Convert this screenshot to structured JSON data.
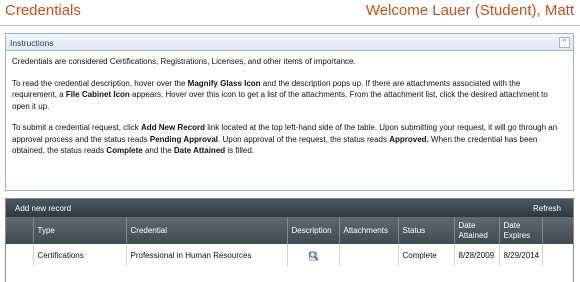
{
  "header": {
    "title": "Credentials",
    "welcome": "Welcome Lauer (Student), Matt"
  },
  "instructions": {
    "title": "Instructions",
    "p1": "Credentials are considered Certifications, Registrations, Licenses, and other items of importance.",
    "p2_a": "To read the credential description, hover over the ",
    "p2_b": "Magnify Glass Icon",
    "p2_c": " and the description pops up.  If there are attachments associated with the requirement, a ",
    "p2_d": "File Cabinet Icon",
    "p2_e": " appears.  Hover over this icon to get a list of the attachments.  From the attachment list, click the desired attachment to open it up.",
    "p3_a": "To submit a credential request, click ",
    "p3_b": "Add New Record",
    "p3_c": " link located at the top left-hand side of the table. Upon submitting your request, it will go through an approval process and the status reads ",
    "p3_d": "Pending Approval",
    "p3_e": ".  Upon approval of the request, the status reads ",
    "p3_f": "Approved.",
    "p3_g": "  When the credential has been obtained, the status reads ",
    "p3_h": "Complete",
    "p3_i": " and the ",
    "p3_j": "Date Attained",
    "p3_k": " is filled."
  },
  "grid": {
    "add_label": "Add new record",
    "refresh_label": "Refresh",
    "columns": {
      "type": "Type",
      "credential": "Credential",
      "description": "Description",
      "attachments": "Attachments",
      "status": "Status",
      "date_attained_1": "Date",
      "date_attained_2": "Attained",
      "date_expires_1": "Date",
      "date_expires_2": "Expires"
    },
    "rows": [
      {
        "type": "Certifications",
        "credential": "Professional in Human Resources",
        "description_icon": "magnify-glass-icon",
        "attachments": "",
        "status": "Complete",
        "date_attained": "8/28/2009",
        "date_expires": "8/29/2014"
      }
    ]
  },
  "colors": {
    "title": "#c5501a",
    "grid_header": "#3e4950",
    "instructions_bar": "#dce7f2"
  }
}
